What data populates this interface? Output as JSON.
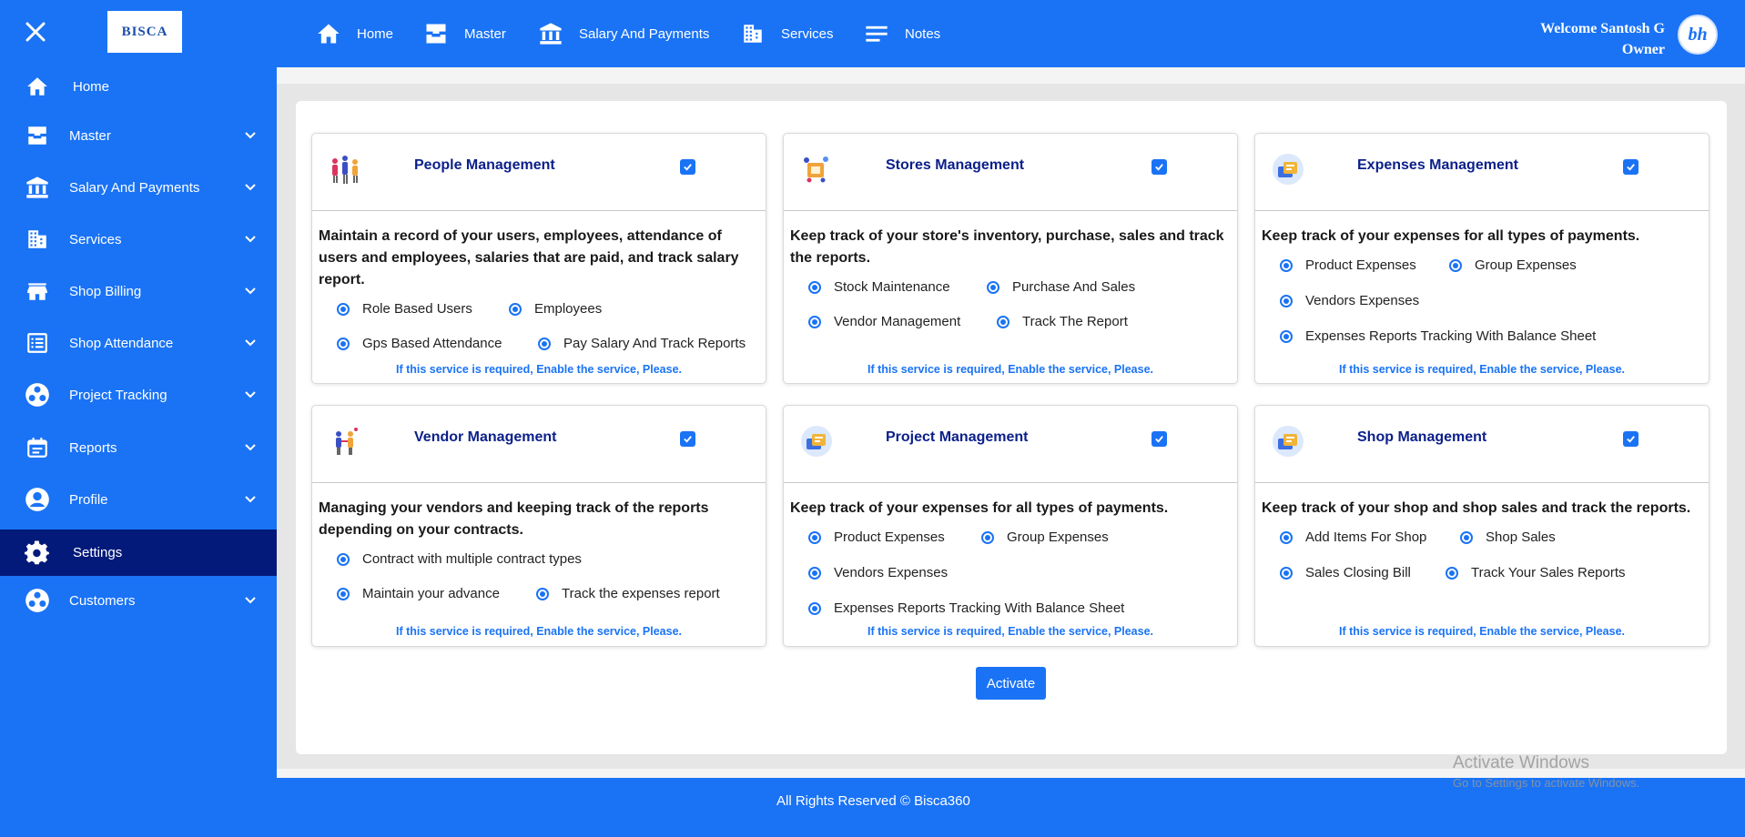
{
  "brand": {
    "logo_text": "BISCA"
  },
  "sidebar": {
    "items": [
      {
        "label": "Home",
        "icon": "home-icon",
        "chevron": false
      },
      {
        "label": "Master",
        "icon": "inbox-icon",
        "chevron": true
      },
      {
        "label": "Salary And Payments",
        "icon": "bank-icon",
        "chevron": true
      },
      {
        "label": "Services",
        "icon": "building-icon",
        "chevron": true
      },
      {
        "label": "Shop Billing",
        "icon": "store-icon",
        "chevron": true
      },
      {
        "label": "Shop Attendance",
        "icon": "list-icon",
        "chevron": true
      },
      {
        "label": "Project Tracking",
        "icon": "circles-icon",
        "chevron": true
      },
      {
        "label": "Reports",
        "icon": "calendar-icon",
        "chevron": true
      },
      {
        "label": "Profile",
        "icon": "user-icon",
        "chevron": true
      },
      {
        "label": "Settings",
        "icon": "gear-icon",
        "chevron": false,
        "active": true
      },
      {
        "label": "Customers",
        "icon": "circles-icon",
        "chevron": true
      }
    ]
  },
  "topnav": {
    "items": [
      {
        "label": "Home",
        "icon": "home-icon"
      },
      {
        "label": "Master",
        "icon": "inbox-icon"
      },
      {
        "label": "Salary And Payments",
        "icon": "bank-icon"
      },
      {
        "label": "Services",
        "icon": "building-icon"
      },
      {
        "label": "Notes",
        "icon": "menu-icon"
      }
    ]
  },
  "user": {
    "welcome": "Welcome Santosh G",
    "role": "Owner",
    "avatar_text": "bh"
  },
  "cards": [
    {
      "title": "People Management",
      "description": "Maintain a record of your users, employees, attendance of users and employees, salaries that are paid, and track salary report.",
      "options": [
        "Role Based Users",
        "Employees",
        "Gps Based Attendance",
        "Pay Salary And Track Reports"
      ],
      "note": "If this service is required, Enable the service, Please."
    },
    {
      "title": "Stores Management",
      "description": "Keep track of your store's inventory, purchase, sales and track the reports.",
      "options": [
        "Stock Maintenance",
        "Purchase And Sales",
        "Vendor Management",
        "Track The Report"
      ],
      "note": "If this service is required, Enable the service, Please."
    },
    {
      "title": "Expenses Management",
      "description": "Keep track of your expenses for all types of payments.",
      "options": [
        "Product Expenses",
        "Group Expenses",
        "Vendors Expenses",
        "Expenses Reports Tracking With Balance Sheet"
      ],
      "note": "If this service is required, Enable the service, Please."
    },
    {
      "title": "Vendor Management",
      "description": "Managing your vendors and keeping track of the reports depending on your contracts.",
      "options": [
        "Contract with multiple contract types",
        "Maintain your advance",
        "Track the expenses report"
      ],
      "note": "If this service is required, Enable the service, Please."
    },
    {
      "title": "Project Management",
      "description": "Keep track of your expenses for all types of payments.",
      "options": [
        "Product Expenses",
        "Group Expenses",
        "Vendors Expenses",
        "Expenses Reports Tracking With Balance Sheet"
      ],
      "note": "If this service is required, Enable the service, Please."
    },
    {
      "title": "Shop Management",
      "description": "Keep track of your shop and shop sales and track the reports.",
      "options": [
        "Add Items For Shop",
        "Shop Sales",
        "Sales Closing Bill",
        "Track Your Sales Reports"
      ],
      "note": "If this service is required, Enable the service, Please."
    }
  ],
  "activate_label": "Activate",
  "footer": {
    "text": "All Rights Reserved © Bisca360"
  },
  "watermark": {
    "line1": "Activate Windows",
    "line2": "Go to Settings to activate Windows."
  },
  "colors": {
    "primary": "#1a73f5",
    "sidebar_active": "#041a7a",
    "title": "#0b1f8a"
  }
}
